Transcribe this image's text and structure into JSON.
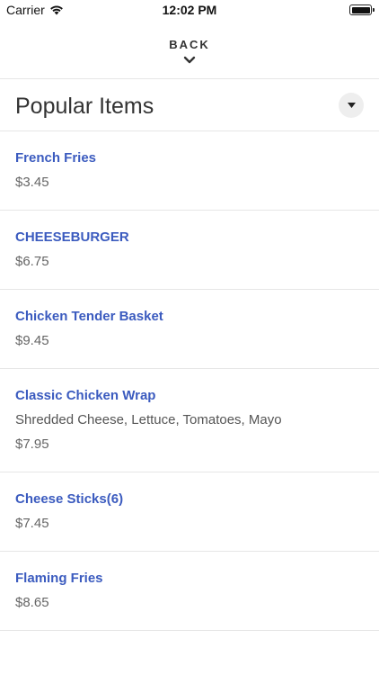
{
  "status_bar": {
    "carrier": "Carrier",
    "time": "12:02 PM"
  },
  "header": {
    "back_label": "BACK"
  },
  "section": {
    "title": "Popular Items"
  },
  "items": [
    {
      "name": "French Fries",
      "description": "",
      "price": "$3.45"
    },
    {
      "name": "CHEESEBURGER",
      "description": "",
      "price": "$6.75"
    },
    {
      "name": "Chicken Tender Basket",
      "description": "",
      "price": "$9.45"
    },
    {
      "name": "Classic Chicken Wrap",
      "description": "Shredded Cheese, Lettuce, Tomatoes, Mayo",
      "price": "$7.95"
    },
    {
      "name": "Cheese Sticks(6)",
      "description": "",
      "price": "$7.45"
    },
    {
      "name": "Flaming Fries",
      "description": "",
      "price": "$8.65"
    }
  ],
  "colors": {
    "item_name": "#3b5bbf",
    "divider": "#e6e6e6"
  },
  "icons": {
    "wifi": "wifi-icon",
    "battery": "battery-icon",
    "back_chevron": "chevron-down-icon",
    "dropdown": "caret-down-icon"
  }
}
